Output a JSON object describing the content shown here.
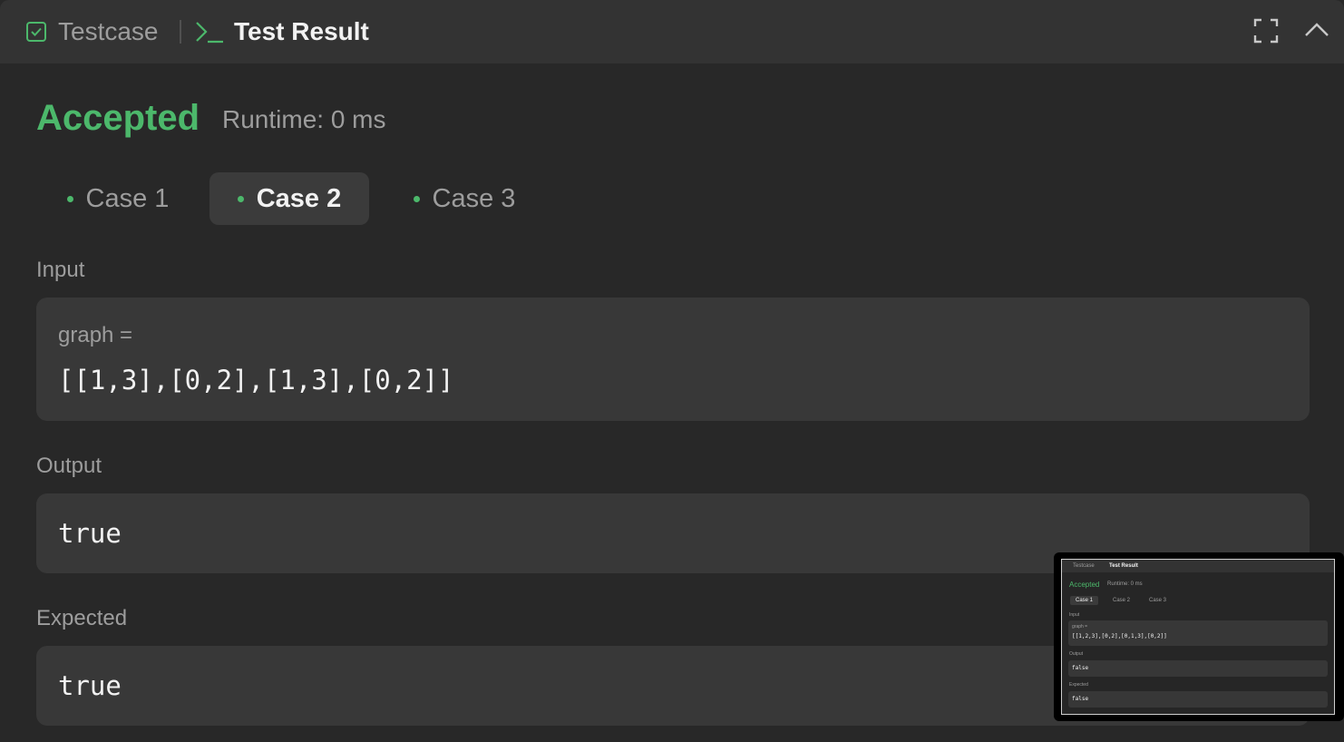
{
  "header": {
    "tab_testcase": "Testcase",
    "tab_result": "Test Result",
    "icons": [
      "checkbox-icon",
      "terminal-icon",
      "fullscreen-icon",
      "chevron-up-icon"
    ]
  },
  "result": {
    "status": "Accepted",
    "runtime": "Runtime: 0 ms",
    "status_color": "#4cb86b"
  },
  "cases": [
    {
      "label": "Case 1",
      "active": false
    },
    {
      "label": "Case 2",
      "active": true
    },
    {
      "label": "Case 3",
      "active": false
    }
  ],
  "input": {
    "label": "Input",
    "var": "graph =",
    "value": "[[1,3],[0,2],[1,3],[0,2]]"
  },
  "output": {
    "label": "Output",
    "value": "true"
  },
  "expected": {
    "label": "Expected",
    "value": "true"
  },
  "thumbnail": {
    "tab_testcase": "Testcase",
    "tab_result": "Test Result",
    "status": "Accepted",
    "runtime": "Runtime: 0 ms",
    "case1": "Case 1",
    "case2": "Case 2",
    "case3": "Case 3",
    "input_label": "Input",
    "var": "graph =",
    "input_value": "[[1,2,3],[0,2],[0,1,3],[0,2]]",
    "output_label": "Output",
    "output_value": "false",
    "expected_label": "Expected",
    "expected_value": "false"
  }
}
